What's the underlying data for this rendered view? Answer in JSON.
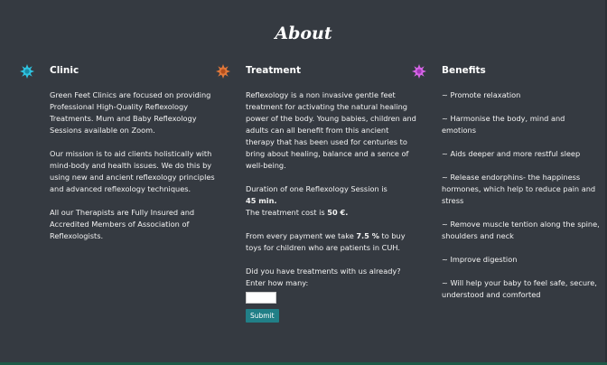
{
  "title": "About",
  "colors": {
    "background": "#353a41",
    "clinic_icon": "#2fc3e0",
    "treatment_icon": "#e0773a",
    "benefits_icon": "#d565e6",
    "button": "#217f87",
    "bottom_bar": "#1e5a48"
  },
  "clinic": {
    "icon": "sun-icon",
    "heading": "Clinic",
    "paragraphs": [
      "Green Feet Clinics are focused on providing Professional High-Quality Reflexology Treatments. Mum and Baby Reflexology Sessions available on Zoom.",
      "Our mission is to aid clients holistically with mind-body and health issues. We do this by using new and ancient reflexology principles and advanced reflexology techniques.",
      "All our Therapists are Fully Insured and Accredited Members of Association of Reflexologists."
    ]
  },
  "treatment": {
    "icon": "sun-icon",
    "heading": "Treatment",
    "intro": "Reflexology is a non invasive gentle feet treatment for activating the natural healing power of the body. Young babies, children and adults can all benefit from this ancient therapy that has been used for centuries to bring about healing, balance and a sence of well-being.",
    "duration_label": "Duration of one Reflexology Session is",
    "duration_value": "45 min.",
    "cost_label": "The treatment cost is",
    "cost_value": "50 €.",
    "donation_pre": "From every payment we take",
    "donation_value": "7.5 %",
    "donation_post": "to buy toys for children who are patients in CUH.",
    "question": "Did you have treatments with us already? Enter how many:",
    "input_value": "",
    "submit_label": "Submit"
  },
  "benefits": {
    "icon": "sun-icon",
    "heading": "Benefits",
    "items": [
      "~ Promote relaxation",
      "~ Harmonise the body, mind and emotions",
      "~ Aids deeper and more restful sleep",
      "~ Release endorphins- the happiness hormones, which help to reduce pain and stress",
      "~ Remove muscle tention along the spine, shoulders and neck",
      "~ Improve digestion",
      "~ Will help your baby to feel safe, secure, understood and comforted"
    ]
  }
}
